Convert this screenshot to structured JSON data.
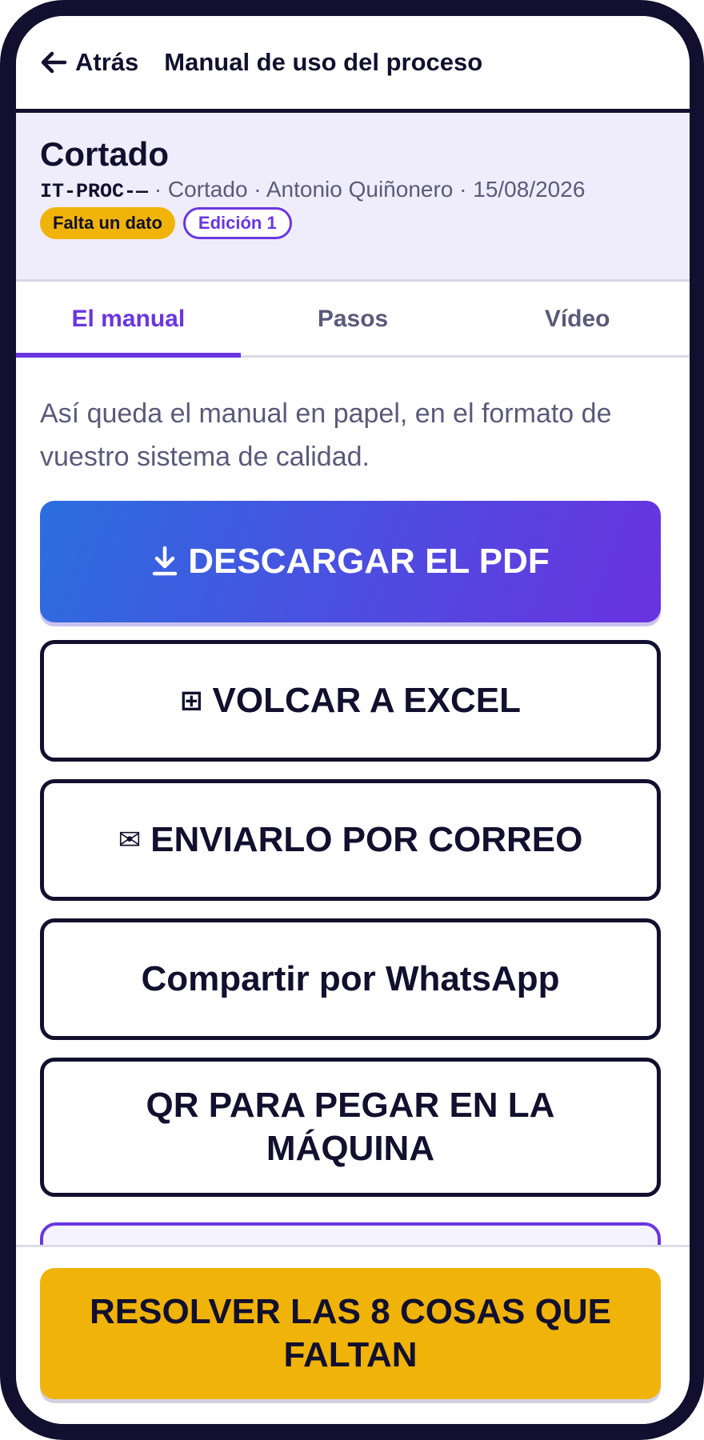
{
  "header": {
    "back_label": "Atrás",
    "title": "Manual de uso del proceso"
  },
  "process": {
    "name": "Cortado",
    "code": "IT-PROC-—",
    "meta_rest": " · Cortado · Antonio Quiñonero · 15/08/2026",
    "badge_missing": "Falta un dato",
    "badge_edition": "Edición 1"
  },
  "tabs": [
    {
      "label": "El manual",
      "active": true
    },
    {
      "label": "Pasos",
      "active": false
    },
    {
      "label": "Vídeo",
      "active": false
    }
  ],
  "main": {
    "intro": "Así queda el manual en papel, en el formato de vuestro sistema de calidad.",
    "download_label": "DESCARGAR EL PDF",
    "excel_label": "VOLCAR A EXCEL",
    "excel_icon": "⊞",
    "mail_label": "ENVIARLO POR CORREO",
    "mail_icon": "✉",
    "whatsapp_label": "Compartir por WhatsApp",
    "qr_label": "QR PARA PEGAR EN LA MÁQUINA"
  },
  "footer": {
    "resolve_label": "RESOLVER LAS 8 COSAS QUE FALTAN"
  },
  "colors": {
    "accent": "#6a36e0",
    "warning": "#f0b30a",
    "ink": "#12102e"
  }
}
